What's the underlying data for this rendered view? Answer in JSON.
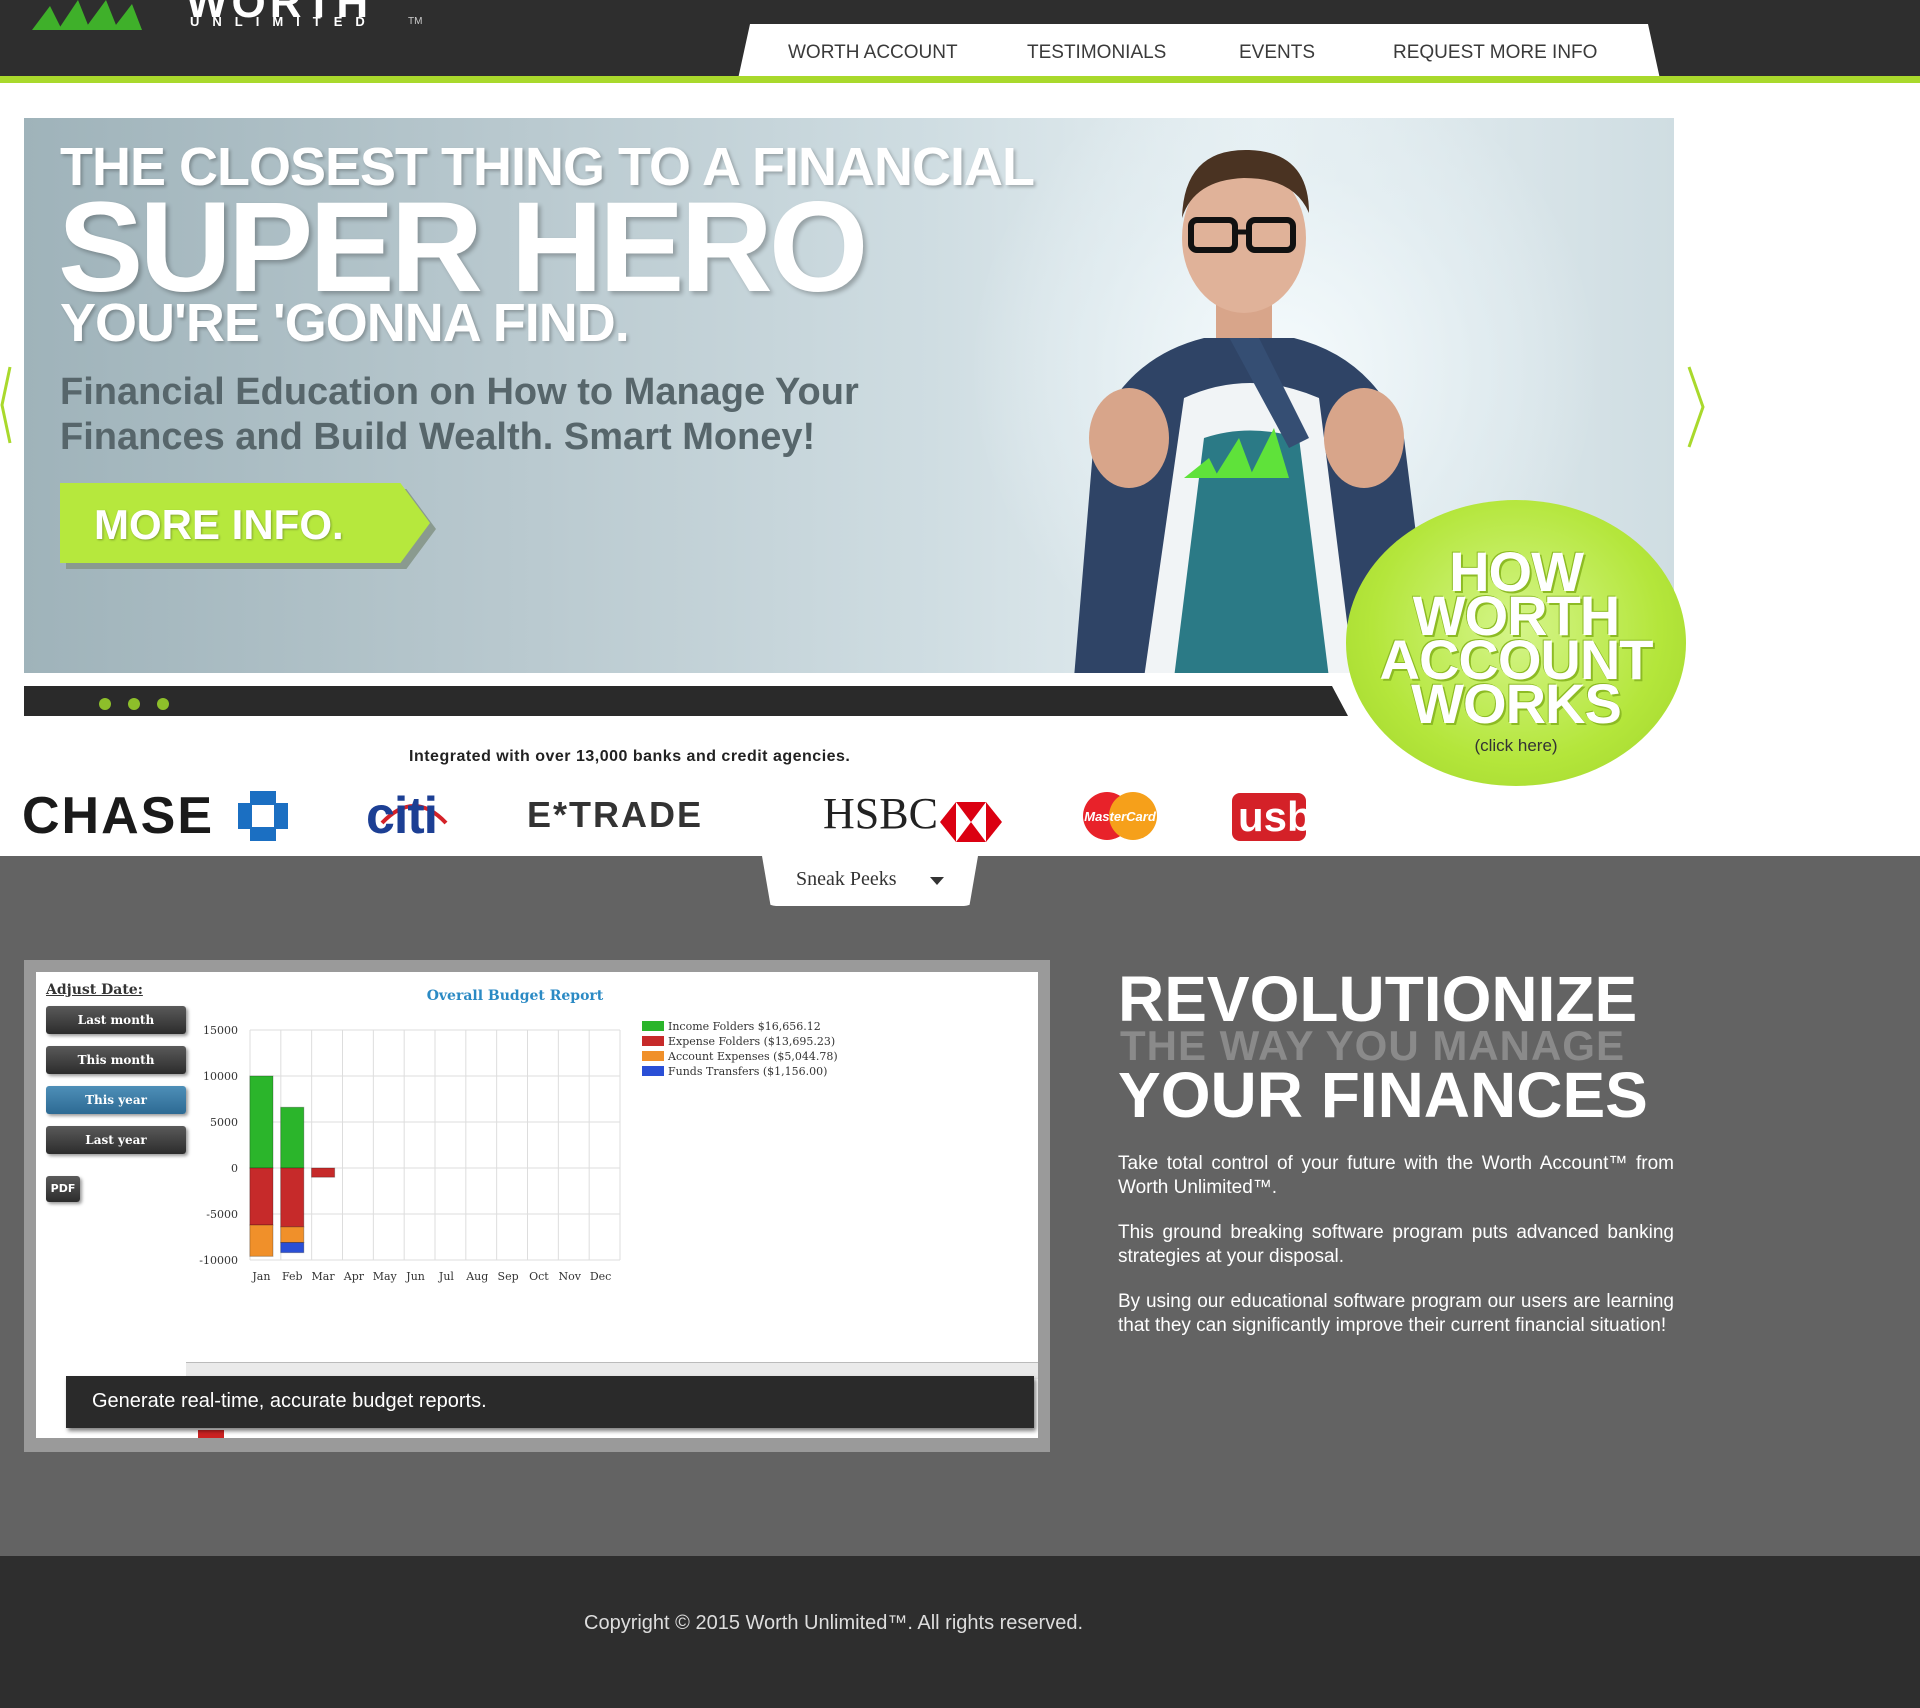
{
  "brand": {
    "logo_word": "WORTH",
    "logo_sub": "UNLIMITED",
    "logo_tm": "TM",
    "accent_color": "#a9d92c",
    "logo_green": "#3fb02a"
  },
  "nav": {
    "items": [
      "WORTH ACCOUNT",
      "TESTIMONIALS",
      "EVENTS",
      "REQUEST MORE INFO"
    ]
  },
  "hero": {
    "line1": "THE CLOSEST THING TO A FINANCIAL",
    "line2": "SUPER HERO",
    "line3": "YOU'RE 'GONNA FIND.",
    "subtitle": "Financial Education on How to Manage Your Finances and Build Wealth. Smart Money!",
    "button_label": "MORE INFO.",
    "prev_icon": "chevron-left-icon",
    "next_icon": "chevron-right-icon",
    "slide_count": 3
  },
  "how_it_works": {
    "text_lines": [
      "HOW",
      "WORTH",
      "ACCOUNT",
      "WORKS"
    ],
    "click_label": "(click here)"
  },
  "banks": {
    "heading": "Integrated with over 13,000 banks and credit agencies.",
    "chase": "CHASE",
    "citi": "citi",
    "etrade": "E*TRADE",
    "hsbc": "HSBC",
    "mastercard": "MasterCard",
    "usb": "usb"
  },
  "sneak": {
    "label": "Sneak Peeks",
    "caret_icon": "caret-down-icon"
  },
  "budget_widget": {
    "adjust_label": "Adjust Date:",
    "buttons": [
      "Last month",
      "This month",
      "This year",
      "Last year"
    ],
    "active_button": "This year",
    "pdf_label": "PDF",
    "caption": "Generate real-time, accurate budget reports."
  },
  "chart_data": {
    "type": "bar",
    "stacked": true,
    "title": "Overall Budget Report",
    "categories": [
      "Jan",
      "Feb",
      "Mar",
      "Apr",
      "May",
      "Jun",
      "Jul",
      "Aug",
      "Sep",
      "Oct",
      "Nov",
      "Dec"
    ],
    "ylim": [
      -10000,
      15000
    ],
    "yticks": [
      15000,
      10000,
      5000,
      0,
      -5000,
      -10000
    ],
    "grid": true,
    "legend_position": "right",
    "series": [
      {
        "name": "Income Folders $16,656.12",
        "color": "#2bb52b",
        "values": [
          10000,
          6600,
          0,
          0,
          0,
          0,
          0,
          0,
          0,
          0,
          0,
          0
        ]
      },
      {
        "name": "Expense Folders ($13,695.23)",
        "color": "#c62a2a",
        "values": [
          -6200,
          -6400,
          -1000,
          0,
          0,
          0,
          0,
          0,
          0,
          0,
          0,
          0
        ]
      },
      {
        "name": "Account Expenses ($5,044.78)",
        "color": "#f0902a",
        "values": [
          -3400,
          -1700,
          0,
          0,
          0,
          0,
          0,
          0,
          0,
          0,
          0,
          0
        ]
      },
      {
        "name": "Funds Transfers ($1,156.00)",
        "color": "#2a4fd6",
        "values": [
          0,
          -1100,
          0,
          0,
          0,
          0,
          0,
          0,
          0,
          0,
          0,
          0
        ]
      }
    ]
  },
  "revolutionize": {
    "line1": "REVOLUTIONIZE",
    "line2": "THE WAY YOU MANAGE",
    "line3": "YOUR FINANCES",
    "paragraphs": [
      "Take total control of your future with the Worth Account™ from Worth Unlimited™.",
      "This ground breaking software program puts advanced banking strategies at your disposal.",
      "By using our educational software program our users are learning that they can significantly improve their current financial situation!"
    ]
  },
  "footer": {
    "copyright": "Copyright © 2015 Worth Unlimited™. All rights reserved."
  }
}
